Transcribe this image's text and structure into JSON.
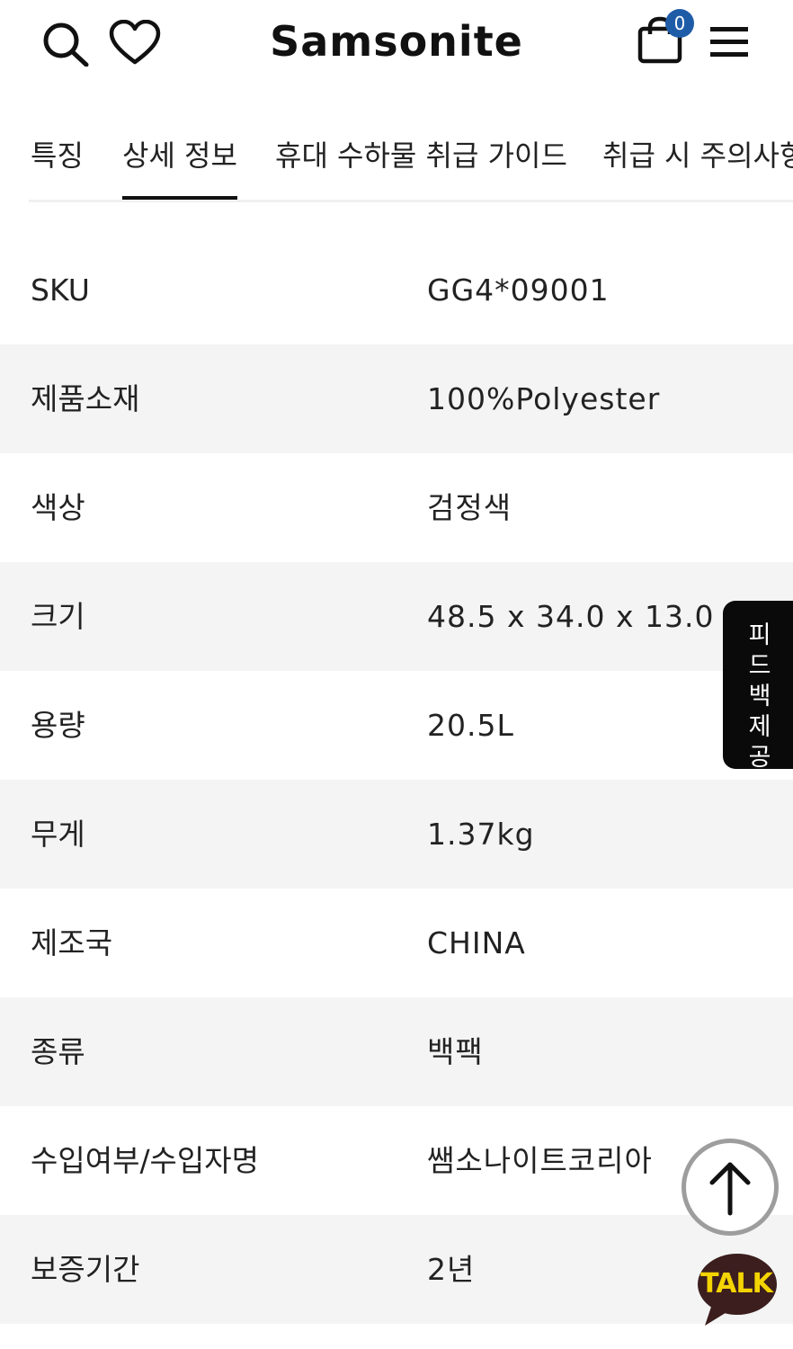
{
  "header": {
    "brand": "Samsonite",
    "cart_count": "0",
    "icons": [
      "search-icon",
      "heart-icon",
      "shopping-bag-icon",
      "hamburger-menu-icon"
    ]
  },
  "tabs": [
    {
      "label": "특징"
    },
    {
      "label": "상세 정보",
      "active": true
    },
    {
      "label": "휴대 수하물 취급 가이드"
    },
    {
      "label": "취급 시 주의사항"
    }
  ],
  "specs": [
    {
      "label": "SKU",
      "value": "GG4*09001"
    },
    {
      "label": "제품소재",
      "value": "100%Polyester"
    },
    {
      "label": "색상",
      "value": "검정색"
    },
    {
      "label": "크기",
      "value": "48.5 x 34.0 x 13.0 cm"
    },
    {
      "label": "용량",
      "value": "20.5L"
    },
    {
      "label": "무게",
      "value": "1.37kg"
    },
    {
      "label": "제조국",
      "value": "CHINA"
    },
    {
      "label": "종류",
      "value": "백팩"
    },
    {
      "label": "수입여부/수입자명",
      "value": "쌤소나이트코리아"
    },
    {
      "label": "보증기간",
      "value": "2년"
    }
  ],
  "floating": {
    "feedback_label": "피드백 제공",
    "talk_label": "TALK"
  },
  "colors": {
    "badge": "#1f5ca8",
    "row_alt": "#f4f4f4",
    "talk_bubble": "#3c1e1e",
    "talk_text": "#f4d400"
  }
}
